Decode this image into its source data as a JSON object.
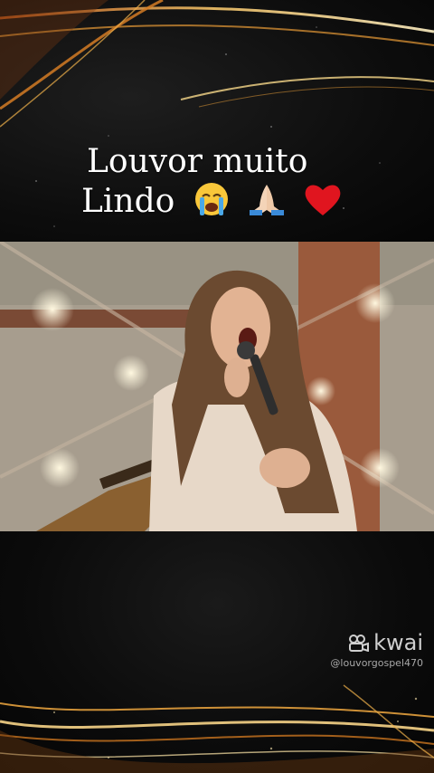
{
  "caption": {
    "line1": "Louvor muito",
    "line2": "Lindo",
    "emojis": [
      "crying-face-icon",
      "praying-hands-icon",
      "red-heart-icon"
    ]
  },
  "video": {
    "content": "woman-singing-into-microphone"
  },
  "watermark": {
    "brand": "kwai",
    "handle": "@louvorgospel470",
    "icon": "kwai-camera-icon"
  },
  "colors": {
    "background": "#0c0c0c",
    "gold": "#e8a63a",
    "caption_text": "#ffffff"
  }
}
